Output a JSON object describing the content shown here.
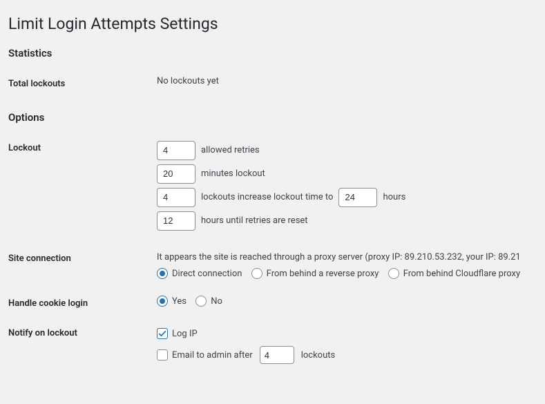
{
  "page_title": "Limit Login Attempts Settings",
  "sections": {
    "statistics_heading": "Statistics",
    "options_heading": "Options"
  },
  "statistics": {
    "total_lockouts_label": "Total lockouts",
    "total_lockouts_value": "No lockouts yet"
  },
  "lockout": {
    "label": "Lockout",
    "allowed_retries_value": "4",
    "allowed_retries_text": "allowed retries",
    "minutes_lockout_value": "20",
    "minutes_lockout_text": "minutes lockout",
    "lockouts_increase_value": "4",
    "lockouts_increase_text": "lockouts increase lockout time to",
    "hours_value": "24",
    "hours_text": "hours",
    "reset_value": "12",
    "reset_text": "hours until retries are reset"
  },
  "site_connection": {
    "label": "Site connection",
    "description": "It appears the site is reached through a proxy server (proxy IP: 89.210.53.232, your IP: 89.21",
    "option_direct": "Direct connection",
    "option_reverse": "From behind a reverse proxy",
    "option_cloudflare": "From behind Cloudflare proxy"
  },
  "cookie_login": {
    "label": "Handle cookie login",
    "option_yes": "Yes",
    "option_no": "No"
  },
  "notify": {
    "label": "Notify on lockout",
    "option_log_ip": "Log IP",
    "option_email_prefix": "Email to admin after",
    "email_after_value": "4",
    "option_email_suffix": "lockouts"
  }
}
